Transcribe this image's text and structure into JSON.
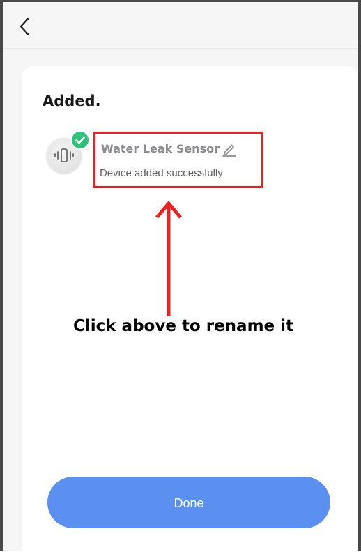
{
  "header": {
    "back_icon": "chevron-left-icon"
  },
  "card": {
    "title": "Added."
  },
  "device": {
    "icon": "vibration-sensor-icon",
    "status_icon": "checkmark-icon",
    "name": "Water Leak Sensor",
    "edit_icon": "pencil-icon",
    "status": "Device added successfully"
  },
  "annotation": {
    "instruction": "Click above to rename it",
    "highlight_color": "#ee1f1f",
    "arrow_icon": "arrow-up-icon"
  },
  "actions": {
    "done_label": "Done"
  },
  "colors": {
    "accent": "#5b8ff0",
    "success": "#2fc27a",
    "background": "#f6f6f7"
  }
}
